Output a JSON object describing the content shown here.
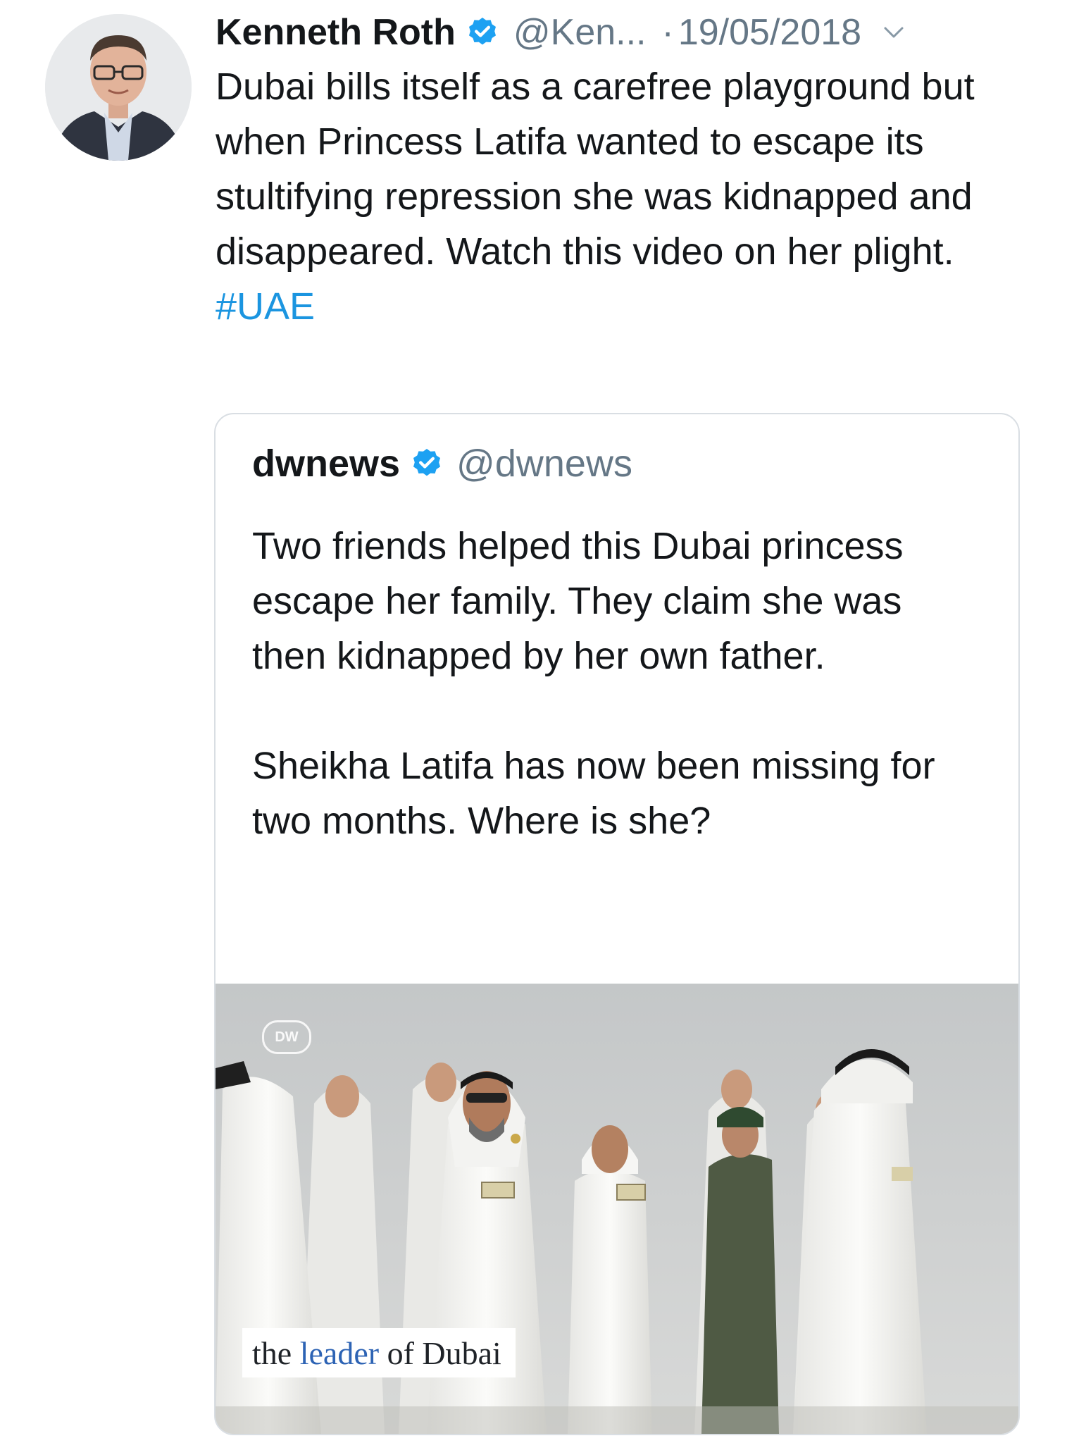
{
  "tweet": {
    "author": {
      "display_name": "Kenneth Roth",
      "handle": "@Ken...",
      "verified": true,
      "avatar": "profile-photo"
    },
    "separator": "·",
    "date": "19/05/2018",
    "menu_icon": "chevron-down-icon",
    "text_before_hashtag": "Dubai bills itself as a carefree playground but when Princess Latifa wanted to escape its stultifying repression she was kidnapped and disappeared. Watch this video on her plight.",
    "hashtag": "#UAE"
  },
  "quoted_tweet": {
    "author": {
      "display_name": "dwnews",
      "handle": "@dwnews",
      "verified": true
    },
    "paragraphs": [
      "Two friends helped this Dubai princess escape her family. They claim she was then kidnapped by her own father.",
      "Sheikha Latifa has now been missing for two months. Where is she?"
    ],
    "media": {
      "watermark": "DW",
      "caption_parts": [
        "the",
        "leader",
        "of Dubai"
      ]
    }
  },
  "colors": {
    "link": "#1b95e0",
    "verified": "#1da1f2",
    "secondary_text": "#657786",
    "caption_highlight": "#2d63b4"
  }
}
